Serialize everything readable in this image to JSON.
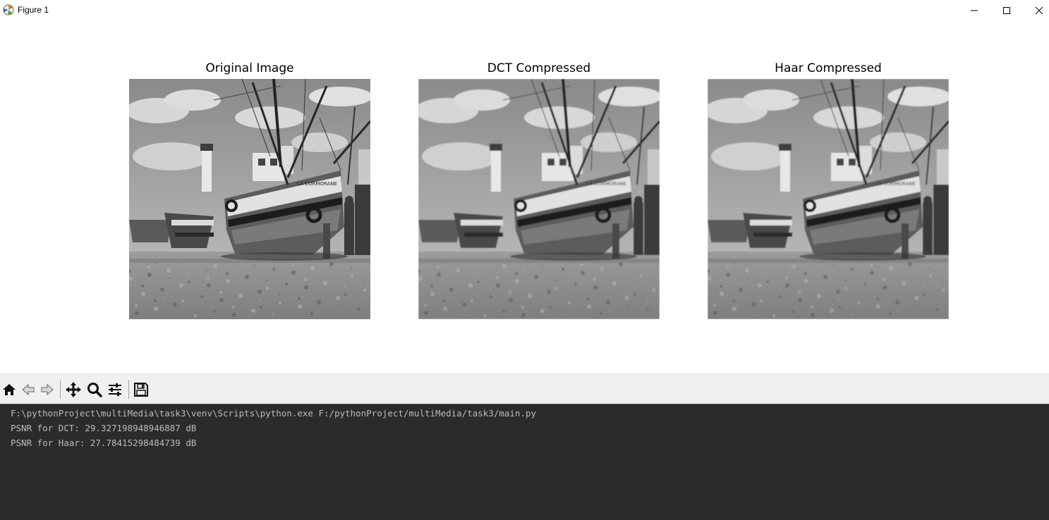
{
  "window": {
    "title": "Figure 1"
  },
  "figure": {
    "panels": [
      {
        "title": "Original Image"
      },
      {
        "title": "DCT Compressed"
      },
      {
        "title": "Haar Compressed"
      }
    ]
  },
  "toolbar": {
    "buttons": [
      "home-icon",
      "back-icon",
      "forward-icon",
      "pan-icon",
      "zoom-icon",
      "configure-subplots-icon",
      "save-icon"
    ]
  },
  "console": {
    "lines": [
      "F:\\pythonProject\\multiMedia\\task3\\venv\\Scripts\\python.exe F:/pythonProject/multiMedia/task3/main.py",
      "PSNR for DCT: 29.327198948946887 dB",
      "PSNR for Haar: 27.78415298484739 dB"
    ]
  }
}
